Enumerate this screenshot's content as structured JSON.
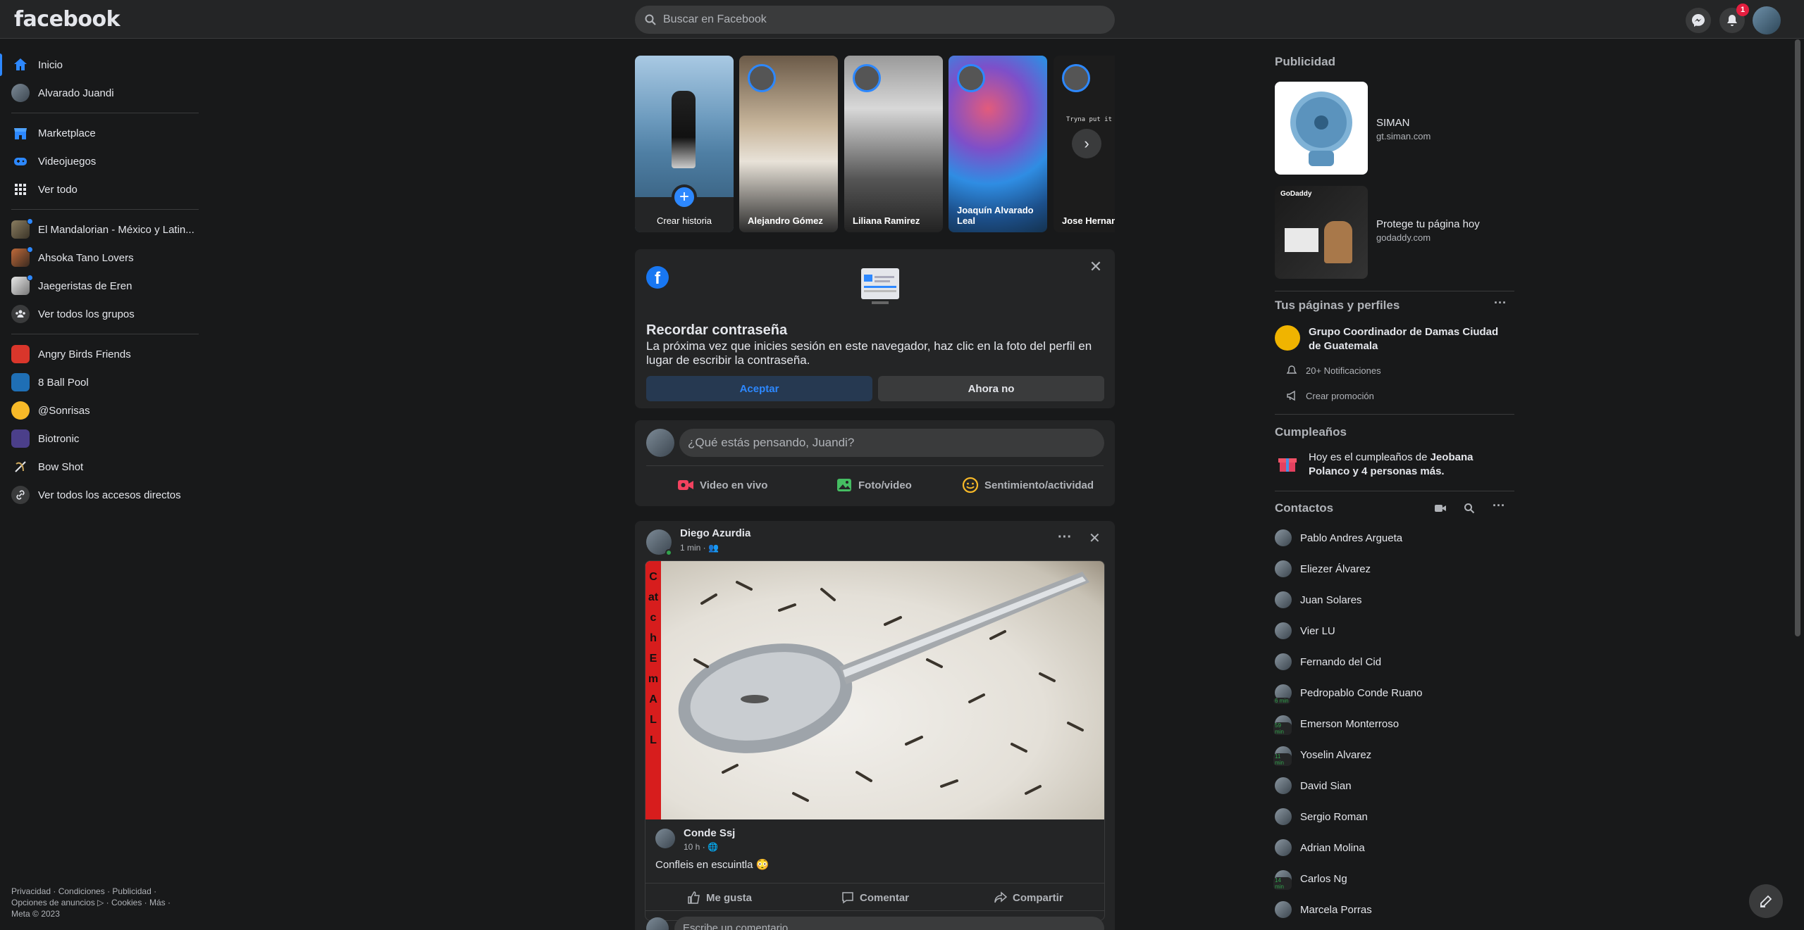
{
  "topbar": {
    "logo": "facebook",
    "search_placeholder": "Buscar en Facebook",
    "notifications_count": "1",
    "icons": [
      "search-icon",
      "messenger-icon",
      "bell-icon",
      "avatar"
    ]
  },
  "left": {
    "items_top": [
      {
        "label": "Inicio",
        "icon": "home-icon"
      },
      {
        "label": "Alvarado Juandi",
        "icon": "avatar"
      }
    ],
    "items_mid": [
      {
        "label": "Marketplace",
        "icon": "store-icon"
      },
      {
        "label": "Videojuegos",
        "icon": "gamepad-icon"
      },
      {
        "label": "Ver todo",
        "icon": "grid-icon"
      }
    ],
    "groups": [
      {
        "label": "El Mandalorian - México y Latin..."
      },
      {
        "label": "Ahsoka Tano Lovers"
      },
      {
        "label": "Jaegeristas de Eren"
      },
      {
        "label": "Ver todos los grupos"
      }
    ],
    "shortcuts": [
      {
        "label": "Angry Birds Friends"
      },
      {
        "label": "8 Ball Pool"
      },
      {
        "label": "@Sonrisas"
      },
      {
        "label": "Biotronic"
      },
      {
        "label": "Bow Shot"
      },
      {
        "label": "Ver todos los accesos directos"
      }
    ],
    "footer_line1": "Privacidad · Condiciones · Publicidad ·",
    "footer_line2": "Opciones de anuncios ▷ · Cookies · Más ·",
    "footer_line3": "Meta © 2023"
  },
  "stories": {
    "create_label": "Crear historia",
    "items": [
      {
        "name": "Alejandro Gómez"
      },
      {
        "name": "Liliana Ramirez"
      },
      {
        "name": "Joaquín Alvarado Leal"
      },
      {
        "name": "Jose Hernandez"
      }
    ],
    "story_text": "Tryna put it so"
  },
  "password_card": {
    "title": "Recordar contraseña",
    "description": "La próxima vez que inicies sesión en este navegador, haz clic en la foto del perfil en lugar de escribir la contraseña.",
    "accept": "Aceptar",
    "decline": "Ahora no"
  },
  "composer": {
    "placeholder": "¿Qué estás pensando, Juandi?",
    "actions": [
      "Video en vivo",
      "Foto/video",
      "Sentimiento/actividad"
    ]
  },
  "post": {
    "author": "Diego Azurdia",
    "time": "1 min · ",
    "image_side_text": "Catch Em ALL",
    "shared_author": "Conde Ssj",
    "shared_time": "10 h · ",
    "shared_text": "Confleis en escuintla",
    "actions": [
      "Me gusta",
      "Comentar",
      "Compartir"
    ],
    "comment_placeholder": "Escribe un comentario..."
  },
  "right": {
    "ads_title": "Publicidad",
    "ads": [
      {
        "name": "SIMAN",
        "domain": "gt.siman.com"
      },
      {
        "name": "Protege tu página hoy",
        "domain": "godaddy.com",
        "brand": "GoDaddy"
      }
    ],
    "pages_title": "Tus páginas y perfiles",
    "page_name": "Grupo Coordinador de Damas Ciudad de Guatemala",
    "page_notifications": "20+ Notificaciones",
    "page_promo": "Crear promoción",
    "birthdays_title": "Cumpleaños",
    "birthday_prefix": "Hoy es el cumpleaños de ",
    "birthday_names": "Jeobana Polanco y 4 personas más.",
    "contacts_title": "Contactos",
    "contacts": [
      {
        "name": "Pablo Andres Argueta",
        "min": ""
      },
      {
        "name": "Eliezer Álvarez",
        "min": ""
      },
      {
        "name": "Juan Solares",
        "min": ""
      },
      {
        "name": "Vier LU",
        "min": ""
      },
      {
        "name": "Fernando del Cid",
        "min": ""
      },
      {
        "name": "Pedropablo Conde Ruano",
        "min": "6 min"
      },
      {
        "name": "Emerson Monterroso",
        "min": "59 min"
      },
      {
        "name": "Yoselin Alvarez",
        "min": "11 min"
      },
      {
        "name": "David Sian",
        "min": ""
      },
      {
        "name": "Sergio Roman",
        "min": ""
      },
      {
        "name": "Adrian Molina",
        "min": ""
      },
      {
        "name": "Carlos Ng",
        "min": "14 min"
      },
      {
        "name": "Marcela Porras",
        "min": ""
      }
    ]
  },
  "colors": {
    "accent": "#2d88ff",
    "bg": "#18191a",
    "card": "#242526",
    "badge": "#e41e3f"
  }
}
